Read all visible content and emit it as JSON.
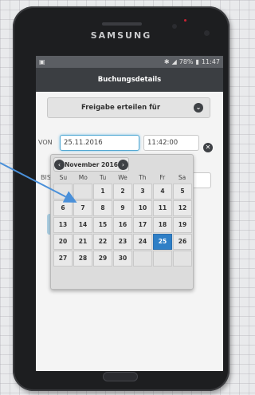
{
  "device": {
    "brand": "SAMSUNG"
  },
  "statusbar": {
    "left_icon": "image-icon",
    "battery": "78%",
    "time": "11:47"
  },
  "app": {
    "title": "Buchungsdetails"
  },
  "dropdown": {
    "label": "Freigabe erteilen für"
  },
  "form": {
    "von_label": "VON",
    "von_date": "25.11.2016",
    "von_time": "11:42:00",
    "bis_label": "BIS"
  },
  "datepicker": {
    "month_title": "November 2016",
    "weekdays": [
      "Su",
      "Mo",
      "Tu",
      "We",
      "Th",
      "Fr",
      "Sa"
    ],
    "weeks": [
      [
        "",
        "",
        "1",
        "2",
        "3",
        "4",
        "5"
      ],
      [
        "6",
        "7",
        "8",
        "9",
        "10",
        "11",
        "12"
      ],
      [
        "13",
        "14",
        "15",
        "16",
        "17",
        "18",
        "19"
      ],
      [
        "20",
        "21",
        "22",
        "23",
        "24",
        "25",
        "26"
      ],
      [
        "27",
        "28",
        "29",
        "30",
        "",
        "",
        ""
      ]
    ],
    "selected_day": "25",
    "accent_color": "#2f7fc6"
  },
  "annotation": {
    "arrow_color": "#4a90d9"
  }
}
